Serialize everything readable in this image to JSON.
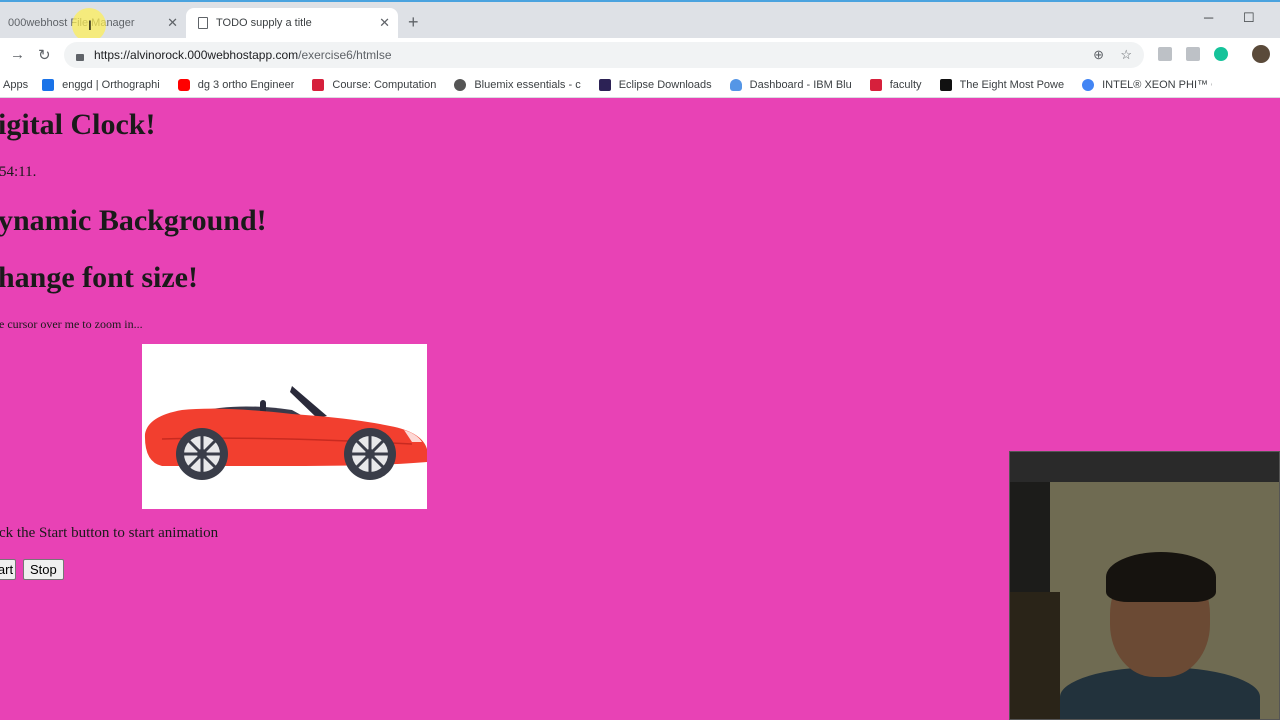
{
  "browser": {
    "tabs": [
      {
        "title": "000webhost File Manager",
        "active": false
      },
      {
        "title": "TODO supply a title",
        "active": true
      }
    ],
    "address": {
      "host": "https://alvinorock.000webhostapp.com",
      "path": "/exercise6/htmlse"
    },
    "bookmarks": [
      {
        "label": "Apps",
        "icon": "apps-grid-icon",
        "color": "#4285f4"
      },
      {
        "label": "enggd | Orthographi",
        "icon": "x-logo-icon",
        "color": "#1a73e8"
      },
      {
        "label": "dg 3 ortho Engineer",
        "icon": "youtube-icon",
        "color": "#ff0000"
      },
      {
        "label": "Course: Computation",
        "icon": "moodle-icon",
        "color": "#d6203c"
      },
      {
        "label": "Bluemix essentials - c",
        "icon": "bluemix-icon",
        "color": "#555555"
      },
      {
        "label": "Eclipse Downloads",
        "icon": "eclipse-icon",
        "color": "#2c2255"
      },
      {
        "label": "Dashboard - IBM Blu",
        "icon": "cloud-icon",
        "color": "#5596e6"
      },
      {
        "label": "faculty",
        "icon": "moodle-icon",
        "color": "#d6203c"
      },
      {
        "label": "The Eight Most Powe",
        "icon": "f-logo-icon",
        "color": "#111111"
      },
      {
        "label": "INTEL® XEON PHI™ C",
        "icon": "google-icon",
        "color": "#4285f4"
      }
    ]
  },
  "page": {
    "background": "#e842b5",
    "clock_heading": "igital Clock!",
    "clock_time": "54:11.",
    "background_heading": "ynamic Background!",
    "font_heading": "hange font size!",
    "zoom_hint": "e cursor over me to zoom in...",
    "animation_hint": "ck the Start button to start animation",
    "start_label": "art",
    "stop_label": "Stop",
    "car": {
      "body_color": "#f23f2f"
    }
  }
}
